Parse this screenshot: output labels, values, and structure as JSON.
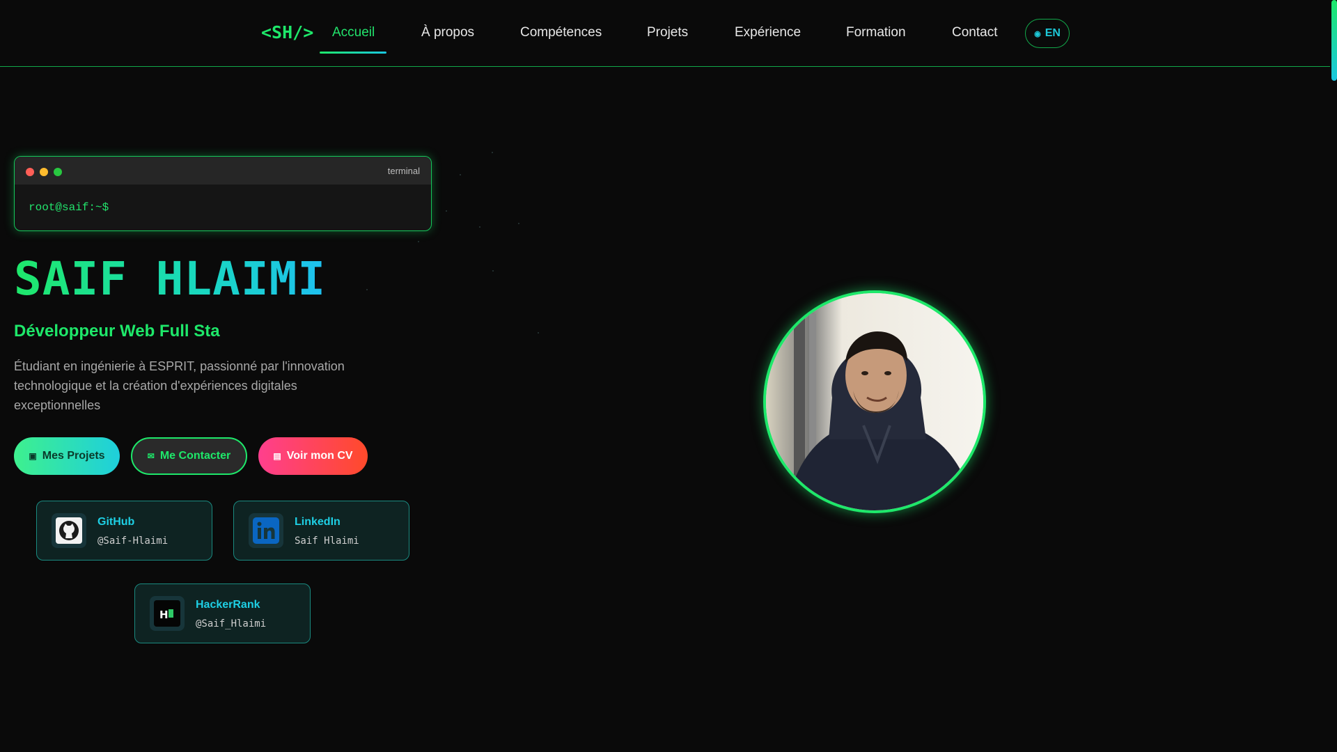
{
  "nav": {
    "logo": "<SH/>",
    "links": [
      "Accueil",
      "À propos",
      "Compétences",
      "Projets",
      "Expérience",
      "Formation",
      "Contact"
    ],
    "active": "Accueil",
    "lang_label": "EN"
  },
  "terminal": {
    "title": "terminal",
    "prompt": "root@saif:~$"
  },
  "hero": {
    "name": "SAIF HLAIMI",
    "role": "Développeur Web Full Sta",
    "description": "Étudiant en ingénierie à ESPRIT, passionné par l'innovation technologique et la création d'expériences digitales exceptionnelles"
  },
  "buttons": {
    "projects": "Mes Projets",
    "contact": "Me Contacter",
    "cv": "Voir mon CV"
  },
  "socials": [
    {
      "name": "GitHub",
      "handle": "@Saif-Hlaimi",
      "icon": "github-icon"
    },
    {
      "name": "LinkedIn",
      "handle": "Saif Hlaimi",
      "icon": "linkedin-icon"
    },
    {
      "name": "HackerRank",
      "handle": "@Saif_Hlaimi",
      "icon": "hackerrank-icon"
    }
  ],
  "colors": {
    "accent_green": "#1ee86a",
    "accent_cyan": "#19c7e0",
    "cv_gradient_start": "#ff3f8e",
    "cv_gradient_end": "#ff4a2a",
    "background": "#0a0a0a"
  }
}
